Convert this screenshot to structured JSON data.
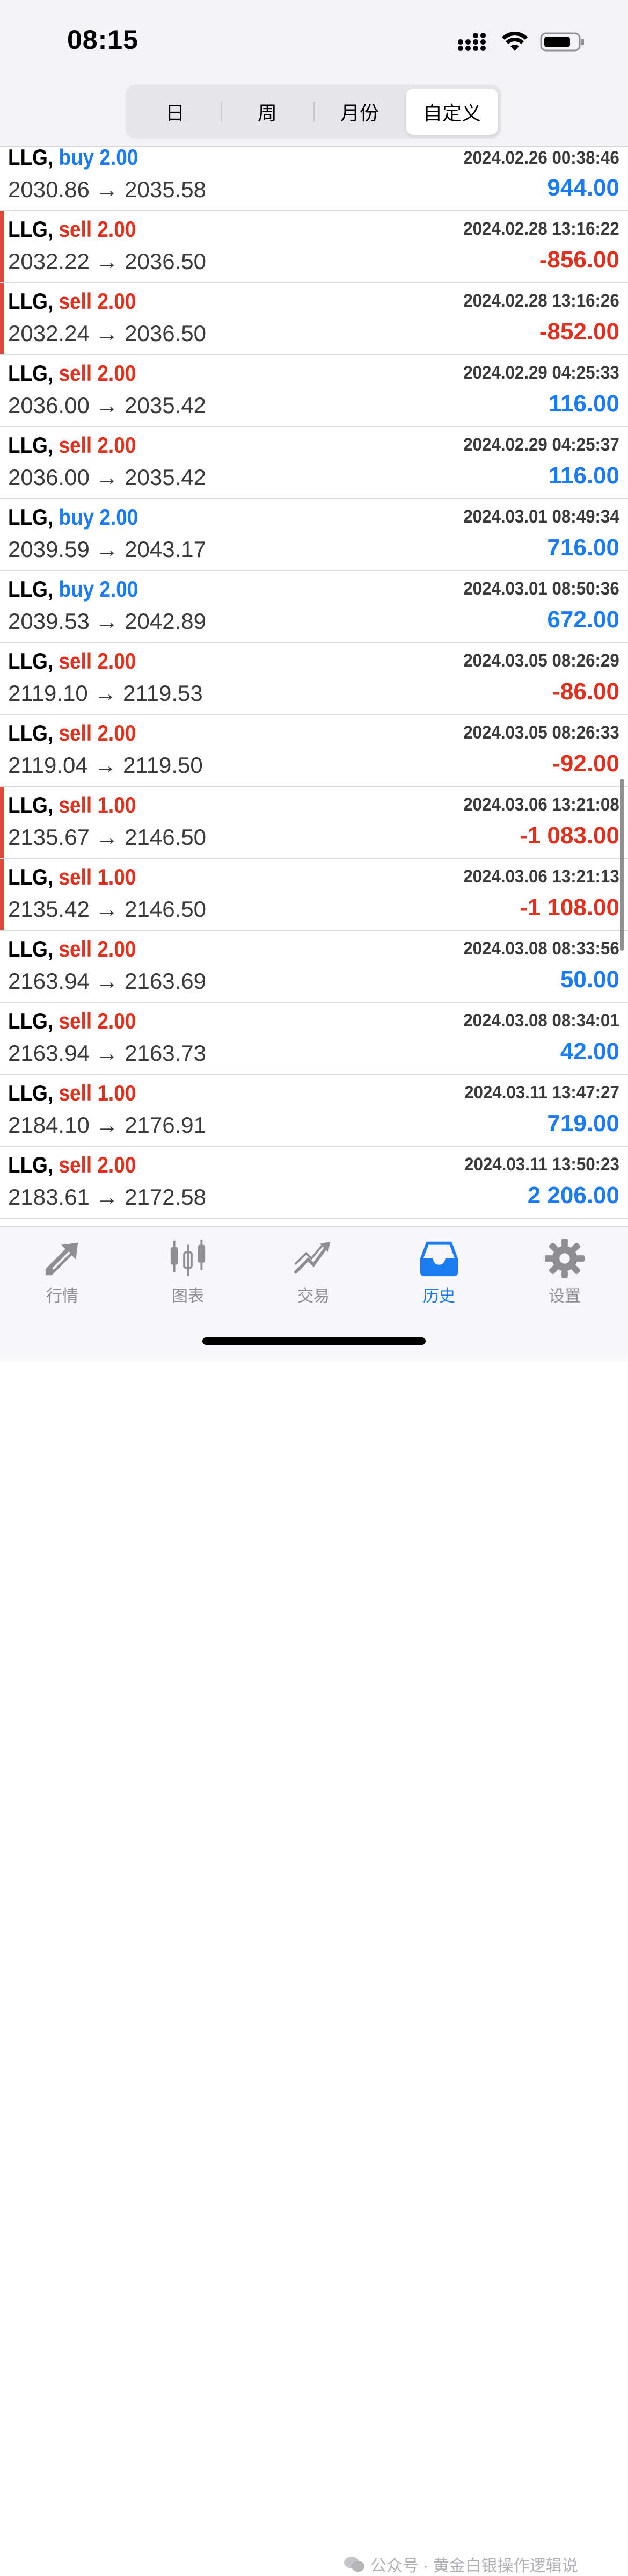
{
  "status_bar": {
    "time": "08:15"
  },
  "period_tabs": [
    {
      "label": "日",
      "active": false
    },
    {
      "label": "周",
      "active": false
    },
    {
      "label": "月份",
      "active": false
    },
    {
      "label": "自定义",
      "active": true
    }
  ],
  "trades": [
    {
      "symbol": "LLG,",
      "side": "buy",
      "volume": "2.00",
      "time": "2024.02.26 00:38:46",
      "open": "2030.86",
      "close": "2035.58",
      "profit": "944.00",
      "profit_sign": "pos",
      "flag": false
    },
    {
      "symbol": "LLG,",
      "side": "sell",
      "volume": "2.00",
      "time": "2024.02.28 13:16:22",
      "open": "2032.22",
      "close": "2036.50",
      "profit": "-856.00",
      "profit_sign": "neg",
      "flag": true
    },
    {
      "symbol": "LLG,",
      "side": "sell",
      "volume": "2.00",
      "time": "2024.02.28 13:16:26",
      "open": "2032.24",
      "close": "2036.50",
      "profit": "-852.00",
      "profit_sign": "neg",
      "flag": true
    },
    {
      "symbol": "LLG,",
      "side": "sell",
      "volume": "2.00",
      "time": "2024.02.29 04:25:33",
      "open": "2036.00",
      "close": "2035.42",
      "profit": "116.00",
      "profit_sign": "pos",
      "flag": false
    },
    {
      "symbol": "LLG,",
      "side": "sell",
      "volume": "2.00",
      "time": "2024.02.29 04:25:37",
      "open": "2036.00",
      "close": "2035.42",
      "profit": "116.00",
      "profit_sign": "pos",
      "flag": false
    },
    {
      "symbol": "LLG,",
      "side": "buy",
      "volume": "2.00",
      "time": "2024.03.01 08:49:34",
      "open": "2039.59",
      "close": "2043.17",
      "profit": "716.00",
      "profit_sign": "pos",
      "flag": false
    },
    {
      "symbol": "LLG,",
      "side": "buy",
      "volume": "2.00",
      "time": "2024.03.01 08:50:36",
      "open": "2039.53",
      "close": "2042.89",
      "profit": "672.00",
      "profit_sign": "pos",
      "flag": false
    },
    {
      "symbol": "LLG,",
      "side": "sell",
      "volume": "2.00",
      "time": "2024.03.05 08:26:29",
      "open": "2119.10",
      "close": "2119.53",
      "profit": "-86.00",
      "profit_sign": "neg",
      "flag": false
    },
    {
      "symbol": "LLG,",
      "side": "sell",
      "volume": "2.00",
      "time": "2024.03.05 08:26:33",
      "open": "2119.04",
      "close": "2119.50",
      "profit": "-92.00",
      "profit_sign": "neg",
      "flag": false
    },
    {
      "symbol": "LLG,",
      "side": "sell",
      "volume": "1.00",
      "time": "2024.03.06 13:21:08",
      "open": "2135.67",
      "close": "2146.50",
      "profit": "-1 083.00",
      "profit_sign": "neg",
      "flag": true
    },
    {
      "symbol": "LLG,",
      "side": "sell",
      "volume": "1.00",
      "time": "2024.03.06 13:21:13",
      "open": "2135.42",
      "close": "2146.50",
      "profit": "-1 108.00",
      "profit_sign": "neg",
      "flag": true
    },
    {
      "symbol": "LLG,",
      "side": "sell",
      "volume": "2.00",
      "time": "2024.03.08 08:33:56",
      "open": "2163.94",
      "close": "2163.69",
      "profit": "50.00",
      "profit_sign": "pos",
      "flag": false
    },
    {
      "symbol": "LLG,",
      "side": "sell",
      "volume": "2.00",
      "time": "2024.03.08 08:34:01",
      "open": "2163.94",
      "close": "2163.73",
      "profit": "42.00",
      "profit_sign": "pos",
      "flag": false
    },
    {
      "symbol": "LLG,",
      "side": "sell",
      "volume": "1.00",
      "time": "2024.03.11 13:47:27",
      "open": "2184.10",
      "close": "2176.91",
      "profit": "719.00",
      "profit_sign": "pos",
      "flag": false
    },
    {
      "symbol": "LLG,",
      "side": "sell",
      "volume": "2.00",
      "time": "2024.03.11 13:50:23",
      "open": "2183.61",
      "close": "2172.58",
      "profit": "2 206.00",
      "profit_sign": "pos",
      "flag": false
    }
  ],
  "arrow": "→",
  "tabbar": [
    {
      "label": "行情",
      "icon": "quotes-icon",
      "active": false
    },
    {
      "label": "图表",
      "icon": "chart-icon",
      "active": false
    },
    {
      "label": "交易",
      "icon": "trade-icon",
      "active": false
    },
    {
      "label": "历史",
      "icon": "history-icon",
      "active": true
    },
    {
      "label": "设置",
      "icon": "gear-icon",
      "active": false
    }
  ],
  "watermark": "公众号 · 黄金白银操作逻辑说",
  "colors": {
    "buy": "#1a7cf0",
    "sell": "#e0311f",
    "loss_flag": "#e0483a",
    "active_tab": "#1a7cf0"
  }
}
